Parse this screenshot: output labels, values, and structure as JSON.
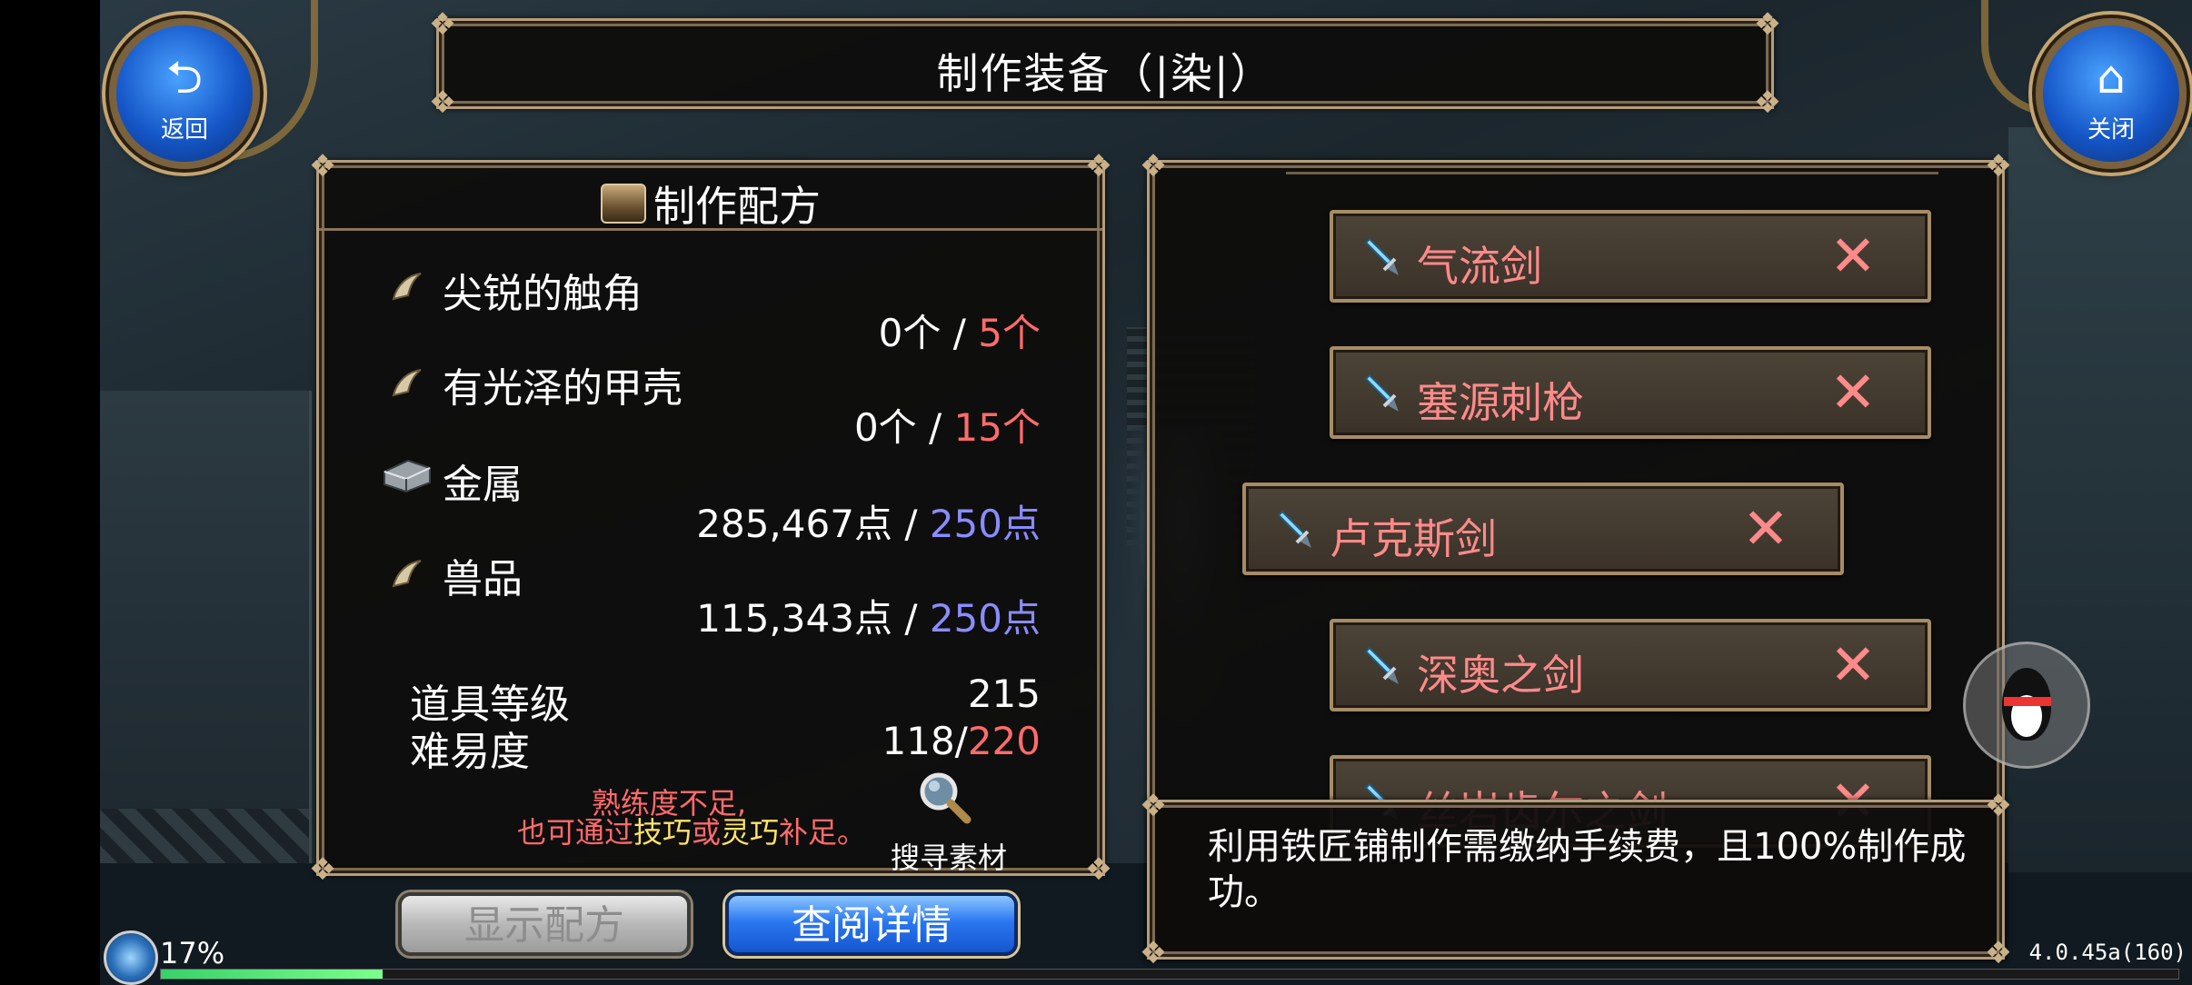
{
  "window": {
    "title": "制作装备（|染|）"
  },
  "nav": {
    "back_label": "返回",
    "close_label": "关闭"
  },
  "recipe": {
    "header": "制作配方",
    "materials": [
      {
        "name": "尖锐的触角",
        "have": "0个",
        "sep": "/",
        "need": "5个",
        "icon": "claw-icon"
      },
      {
        "name": "有光泽的甲壳",
        "have": "0个",
        "sep": "/",
        "need": "15个",
        "icon": "claw-icon"
      },
      {
        "name": "金属",
        "have": "285,467点",
        "sep": "/",
        "need": "250点",
        "icon": "metal-icon"
      },
      {
        "name": "兽品",
        "have": "115,343点",
        "sep": "/",
        "need": "250点",
        "icon": "claw-icon"
      }
    ],
    "item_level_label": "道具等级",
    "item_level_value": "215",
    "difficulty_label": "难易度",
    "difficulty_current": "118/",
    "difficulty_max": "220",
    "warning_line1": "熟练度不足,",
    "warning_line2_pre": "也可通过",
    "warning_line2_skill": "技巧",
    "warning_line2_or": "或",
    "warning_line2_dex": "灵巧",
    "warning_line2_post": "补足。",
    "search_label": "搜寻素材"
  },
  "buttons": {
    "show_recipe": "显示配方",
    "view_details": "查阅详情"
  },
  "equipment": [
    {
      "name": "气流剑"
    },
    {
      "name": "塞源刺枪"
    },
    {
      "name": "卢克斯剑",
      "selected": true
    },
    {
      "name": "深奥之剑"
    },
    {
      "name": "丝岩齿尔之剑"
    }
  ],
  "info": {
    "text": "利用铁匠铺制作需缴纳手续费，且100%制作成功。"
  },
  "hud": {
    "percent": "17%",
    "progress": 0.11,
    "version": "4.0.45a(160)"
  },
  "colors": {
    "need_red": "#ff6b6b",
    "need_blue": "#8a8cff",
    "equip_name": "#ff8a8a",
    "accent_gold": "#b49d7c"
  }
}
